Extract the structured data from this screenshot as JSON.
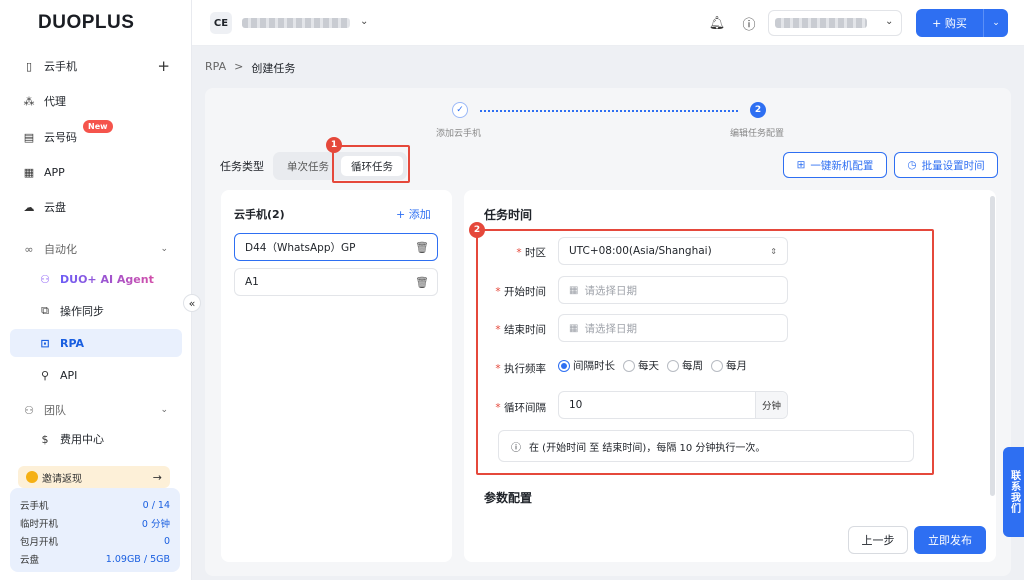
{
  "brand": {
    "logo": "DUOPLUS"
  },
  "sidebar": {
    "items": [
      {
        "label": "云手机",
        "icon": "phone-icon"
      },
      {
        "label": "代理",
        "icon": "proxy-icon"
      },
      {
        "label": "云号码",
        "icon": "sim-icon",
        "badge": "New"
      },
      {
        "label": "APP",
        "icon": "apps-icon"
      },
      {
        "label": "云盘",
        "icon": "cloud-icon"
      },
      {
        "label": "自动化",
        "icon": "infinity-icon"
      },
      {
        "label": "DUO+ AI Agent",
        "icon": "agent-icon"
      },
      {
        "label": "操作同步",
        "icon": "sync-icon"
      },
      {
        "label": "RPA",
        "icon": "robot-icon"
      },
      {
        "label": "API",
        "icon": "api-icon"
      },
      {
        "label": "团队",
        "icon": "team-icon"
      },
      {
        "label": "费用中心",
        "icon": "billing-icon"
      }
    ],
    "collapse_glyph": "«",
    "invite": {
      "label": "邀请返现",
      "arrow": "→"
    },
    "quota": [
      {
        "label": "云手机",
        "value": "0 / 14"
      },
      {
        "label": "临时开机",
        "value": "0 分钟"
      },
      {
        "label": "包月开机",
        "value": "0"
      },
      {
        "label": "云盘",
        "value": "1.09GB / 5GB"
      }
    ]
  },
  "topbar": {
    "workspace_initials": "CE",
    "buy_label": "+ 购买"
  },
  "breadcrumb": {
    "root": "RPA",
    "sep": ">",
    "current": "创建任务"
  },
  "steps": [
    {
      "number": "✓",
      "label": "添加云手机"
    },
    {
      "number": "2",
      "label": "编辑任务配置"
    }
  ],
  "task_type": {
    "label": "任务类型",
    "options": [
      "单次任务",
      "循环任务"
    ],
    "selected": "循环任务"
  },
  "annotations": [
    "1",
    "2"
  ],
  "actions": {
    "one_click_config": "一键新机配置",
    "batch_time": "批量设置时间"
  },
  "phones": {
    "title": "云手机(2)",
    "add_label": "+ 添加",
    "items": [
      "D44（WhatsApp）GP",
      "A1"
    ]
  },
  "task_time": {
    "title": "任务时间",
    "timezone": {
      "label": "时区",
      "value": "UTC+08:00(Asia/Shanghai)"
    },
    "start": {
      "label": "开始时间",
      "placeholder": "请选择日期"
    },
    "end": {
      "label": "结束时间",
      "placeholder": "请选择日期"
    },
    "frequency": {
      "label": "执行频率",
      "options": [
        "间隔时长",
        "每天",
        "每周",
        "每月"
      ],
      "selected": "间隔时长"
    },
    "interval": {
      "label": "循环间隔",
      "value": "10",
      "unit": "分钟"
    },
    "hint": "在 (开始时间 至 结束时间)，每隔 10 分钟执行一次。"
  },
  "params": {
    "title": "参数配置"
  },
  "footer": {
    "prev": "上一步",
    "publish": "立即发布"
  },
  "contact": {
    "label": "联系我们"
  },
  "colors": {
    "primary": "#2e6ff2",
    "annotation": "#e5483b"
  }
}
